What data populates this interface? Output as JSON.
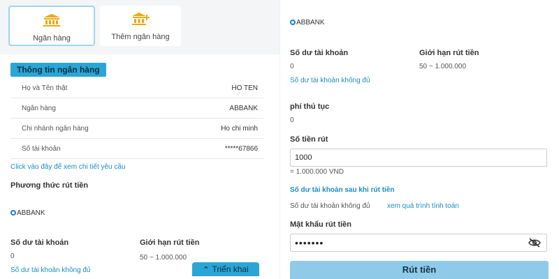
{
  "tabs": [
    {
      "label": "Ngân hàng",
      "icon": "bank-icon"
    },
    {
      "label": "Thêm ngân hàng",
      "icon": "add-bank-icon"
    }
  ],
  "bank_info": {
    "button_label": "Thông tin ngân hàng",
    "rows": [
      {
        "label": "Họ và Tên thật",
        "value": "HO TEN"
      },
      {
        "label": "Ngân hàng",
        "value": "ABBANK"
      },
      {
        "label": "Chi nhánh ngân hàng",
        "value": "Ho chi minh"
      },
      {
        "label": "Số tài khoản",
        "value": "*****67866"
      }
    ],
    "detail_link": "Click vào đây để xem chi tiết yêu cầu"
  },
  "withdraw_method": {
    "heading": "Phương thức rút tiền",
    "bank_option": "ABBANK",
    "balance_label": "Số dư tài khoản",
    "balance_value": "0",
    "limit_label": "Giới hạn rút tiền",
    "limit_value": "50 ~ 1.000.000",
    "insufficient_link": "Số dư tài khoản không đủ"
  },
  "expand_button": {
    "label": "Triển khai"
  },
  "right": {
    "bank_option": "ABBANK",
    "balance_label": "Số dư tài khoản",
    "balance_value": "0",
    "limit_label": "Giới hạn rút tiền",
    "limit_value": "50 ~ 1.000.000",
    "insufficient_link": "Số dư tài khoản không đủ",
    "fee_label": "phí thủ tục",
    "fee_value": "0",
    "amount_label": "Số tiền rút",
    "amount_value": "1000",
    "amount_converted": "= 1.000.000 VND",
    "after_balance_link": "Số dư tài khoản sau khi rút tiền",
    "after_balance_text": "Số dư tài khoản không đủ",
    "calc_link": "xem quá trình tính toán",
    "password_label": "Mật khẩu rút tiền",
    "password_value": "•••••••",
    "submit_label": "Rút tiền"
  },
  "colors": {
    "accent": "#2aa5d5",
    "link": "#1a8cc6",
    "icon_gold": "#e8a919"
  }
}
